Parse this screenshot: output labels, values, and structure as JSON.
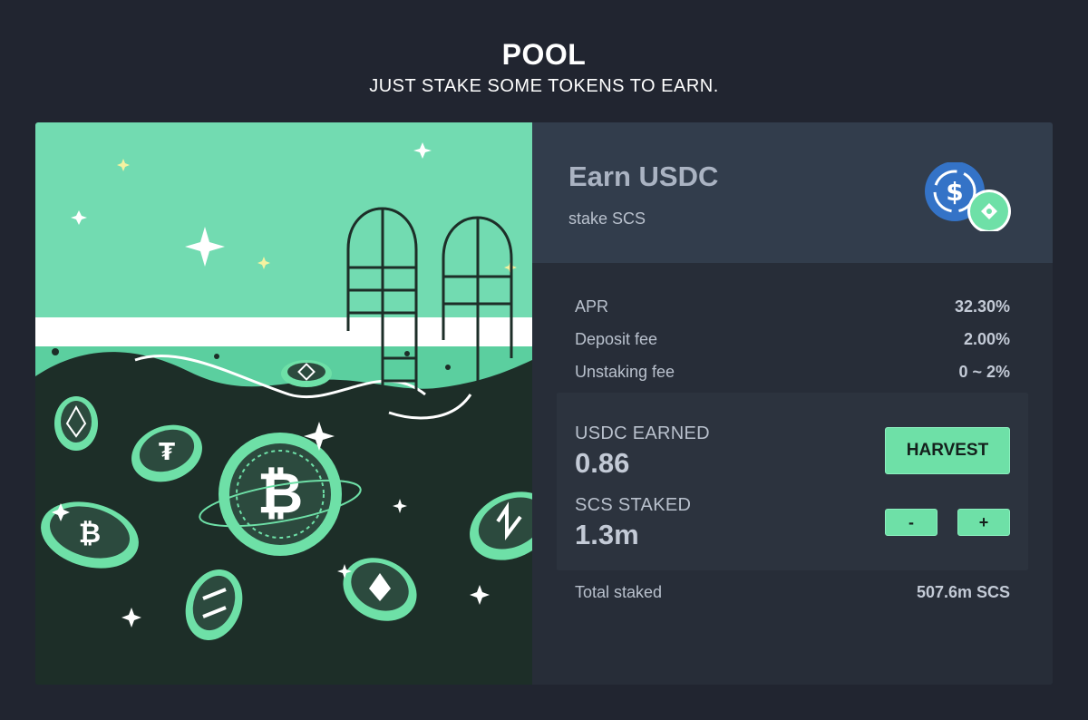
{
  "header": {
    "title": "POOL",
    "subtitle": "JUST STAKE SOME TOKENS TO EARN."
  },
  "pool": {
    "title": "Earn USDC",
    "subtitle": "stake SCS",
    "stats": [
      {
        "label": "APR",
        "value": "32.30%"
      },
      {
        "label": "Deposit fee",
        "value": "2.00%"
      },
      {
        "label": "Unstaking fee",
        "value": "0 ~ 2%"
      }
    ],
    "earned": {
      "label": "USDC EARNED",
      "value": "0.86"
    },
    "staked": {
      "label": "SCS STAKED",
      "value": "1.3m"
    },
    "buttons": {
      "harvest": "HARVEST",
      "minus": "-",
      "plus": "+"
    },
    "total": {
      "label": "Total staked",
      "value": "507.6m SCS"
    }
  },
  "colors": {
    "accent": "#6ee0a7",
    "background": "#212530",
    "panel": "#272d38",
    "panel_header": "#323d4c",
    "usdc_blue": "#3473c7"
  },
  "icons": [
    "usdc-icon",
    "scs-token-icon",
    "bitcoin-coin-icon",
    "sparkle-icon",
    "pool-ladder-icon"
  ]
}
